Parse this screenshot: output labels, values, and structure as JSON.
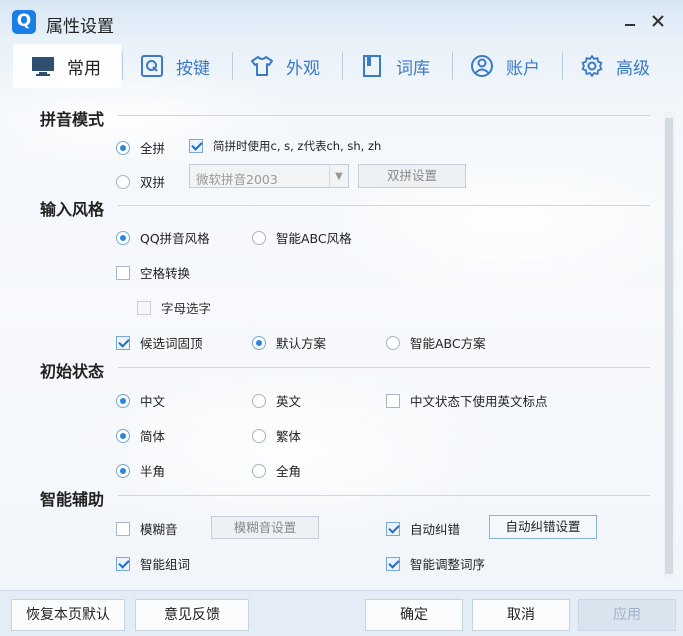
{
  "window": {
    "title": "属性设置",
    "logo_letter": "Q"
  },
  "tabs": [
    {
      "label": "常用",
      "icon": "monitor-icon",
      "active": true
    },
    {
      "label": "按键",
      "icon": "q-key-icon",
      "active": false
    },
    {
      "label": "外观",
      "icon": "tshirt-icon",
      "active": false
    },
    {
      "label": "词库",
      "icon": "book-icon",
      "active": false
    },
    {
      "label": "账户",
      "icon": "user-icon",
      "active": false
    },
    {
      "label": "高级",
      "icon": "gear-icon",
      "active": false
    }
  ],
  "pinyin_mode": {
    "title": "拼音模式",
    "full": "全拼",
    "jianpin": "简拼时使用c, s, z代表ch, sh, zh",
    "double": "双拼",
    "double_scheme": "微软拼音2003",
    "double_settings": "双拼设置"
  },
  "input_style": {
    "title": "输入风格",
    "qq_style": "QQ拼音风格",
    "abc_style": "智能ABC风格",
    "space_convert": "空格转换",
    "letter_select": "字母选字",
    "fixed_candidate": "候选词固顶",
    "default_scheme": "默认方案",
    "abc_scheme": "智能ABC方案"
  },
  "initial_state": {
    "title": "初始状态",
    "chinese": "中文",
    "english": "英文",
    "en_punct": "中文状态下使用英文标点",
    "simplified": "简体",
    "traditional": "繁体",
    "half_width": "半角",
    "full_width": "全角"
  },
  "smart_assist": {
    "title": "智能辅助",
    "fuzzy": "模糊音",
    "fuzzy_settings": "模糊音设置",
    "autocorrect": "自动纠错",
    "autocorrect_settings": "自动纠错设置",
    "smart_words": "智能组词",
    "smart_order": "智能调整词序"
  },
  "footer": {
    "restore": "恢复本页默认",
    "feedback": "意见反馈",
    "ok": "确定",
    "cancel": "取消",
    "apply": "应用"
  },
  "colors": {
    "accent": "#2b86de",
    "tab_text": "#3a7ac9",
    "logo": "#1a7ee6"
  }
}
